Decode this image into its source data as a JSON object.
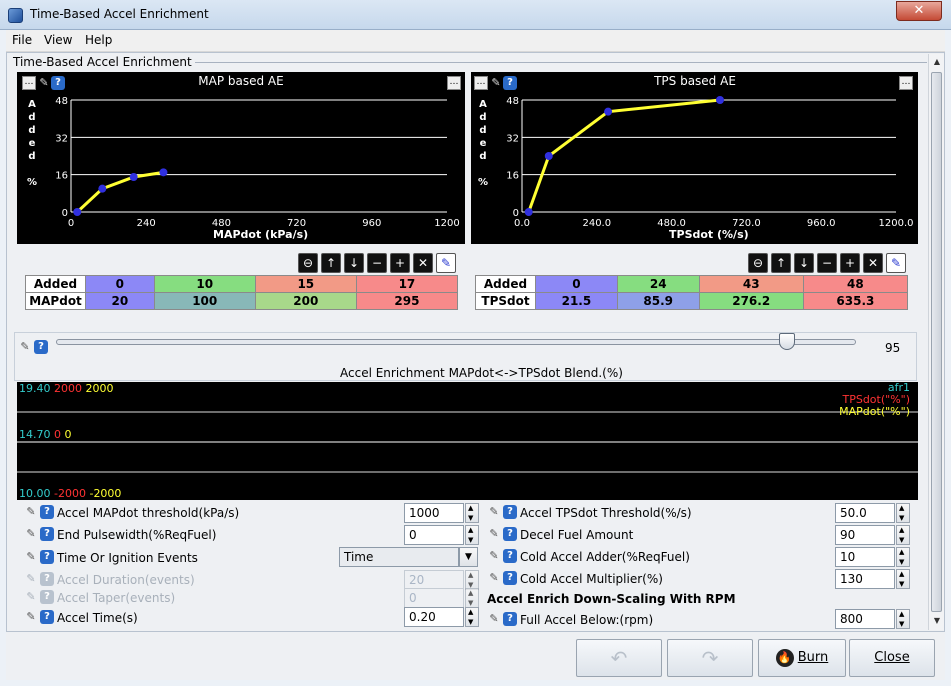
{
  "window": {
    "title": "Time-Based Accel Enrichment",
    "close_glyph": "✕"
  },
  "menu": [
    "File",
    "View",
    "Help"
  ],
  "group_title": "Time-Based Accel Enrichment",
  "map_chart": {
    "title": "MAP based AE",
    "ylabel_letters": [
      "A",
      "d",
      "d",
      "e",
      "d",
      "",
      "%"
    ],
    "xlabel": "MAPdot (kPa/s)",
    "y_ticks": [
      "48",
      "32",
      "16",
      "0"
    ],
    "x_ticks": [
      "0",
      "240",
      "480",
      "720",
      "960",
      "1200"
    ]
  },
  "tps_chart": {
    "title": "TPS based AE",
    "ylabel_letters": [
      "A",
      "d",
      "d",
      "e",
      "d",
      "",
      "%"
    ],
    "xlabel": "TPSdot (%/s)",
    "y_ticks": [
      "48",
      "32",
      "16",
      "0"
    ],
    "x_ticks": [
      "0.0",
      "240.0",
      "480.0",
      "720.0",
      "960.0",
      "1200.0"
    ]
  },
  "chart_data": [
    {
      "type": "line",
      "title": "MAP based AE",
      "xlabel": "MAPdot (kPa/s)",
      "ylabel": "Added %",
      "xlim": [
        0,
        1200
      ],
      "ylim": [
        0,
        48
      ],
      "series": [
        {
          "x": [
            20,
            100,
            200,
            295
          ],
          "values": [
            0,
            10,
            15,
            17
          ]
        }
      ]
    },
    {
      "type": "line",
      "title": "TPS based AE",
      "xlabel": "TPSdot (%/s)",
      "ylabel": "Added %",
      "xlim": [
        0,
        1200
      ],
      "ylim": [
        0,
        48
      ],
      "series": [
        {
          "x": [
            21.5,
            85.9,
            276.2,
            635.3
          ],
          "values": [
            0,
            24,
            43,
            48
          ]
        }
      ]
    }
  ],
  "map_table": {
    "row1_label": "Added",
    "row2_label": "MAPdot",
    "added": [
      "0",
      "10",
      "15",
      "17"
    ],
    "dot": [
      "20",
      "100",
      "200",
      "295"
    ]
  },
  "tps_table": {
    "row1_label": "Added",
    "row2_label": "TPSdot",
    "added": [
      "0",
      "24",
      "43",
      "48"
    ],
    "dot": [
      "21.5",
      "85.9",
      "276.2",
      "635.3"
    ]
  },
  "table_buttons": [
    "⊖",
    "↑",
    "↓",
    "−",
    "+",
    "✕",
    "✎"
  ],
  "blend": {
    "label": "Accel Enrichment MAPdot<->TPSdot Blend.(%)",
    "value": "95",
    "fraction": 0.95
  },
  "strip": {
    "top": [
      "19.40",
      "2000",
      "2000"
    ],
    "mid": [
      "14.70",
      "0",
      "0"
    ],
    "bot": [
      "10.00",
      "-2000",
      "-2000"
    ],
    "legend": [
      "afr1",
      "TPSdot(\"%\")",
      "MAPdot(\"%\")"
    ],
    "colors": {
      "afr": "#33cccc",
      "tps": "#ff3333",
      "map": "#ffff33"
    }
  },
  "left_fields": [
    {
      "label": "Accel MAPdot threshold(kPa/s)",
      "value": "1000"
    },
    {
      "label": "End Pulsewidth(%ReqFuel)",
      "value": "0"
    },
    {
      "label": "Time Or Ignition Events",
      "value": "Time"
    },
    {
      "label": "Accel Duration(events)",
      "value": "20"
    },
    {
      "label": "Accel Taper(events)",
      "value": "0"
    },
    {
      "label": "Accel Time(s)",
      "value": "0.20"
    }
  ],
  "right_fields": [
    {
      "label": "Accel TPSdot Threshold(%/s)",
      "value": "50.0"
    },
    {
      "label": "Decel Fuel Amount",
      "value": "90"
    },
    {
      "label": "Cold Accel Adder(%ReqFuel)",
      "value": "10"
    },
    {
      "label": "Cold Accel Multiplier(%)",
      "value": "130"
    },
    {
      "label": "Accel Enrich Down-Scaling With RPM",
      "value": ""
    },
    {
      "label": "Full Accel Below:(rpm)",
      "value": "800"
    }
  ],
  "buttons": {
    "burn": "Burn",
    "close": "Close"
  }
}
